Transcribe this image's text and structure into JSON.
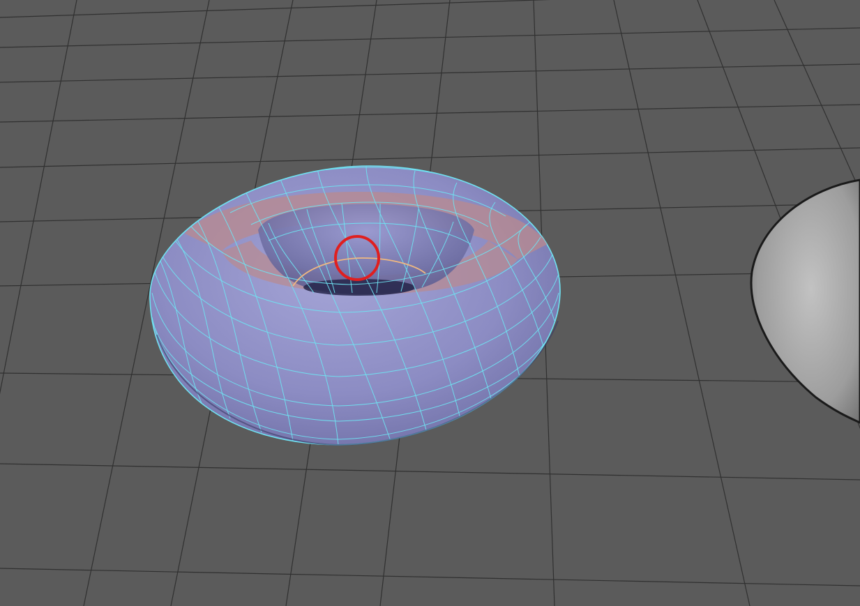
{
  "viewport": {
    "background_color": "#5b5b5b",
    "grid_color": "#2f2f2f"
  },
  "torus": {
    "fill_color": "#8f8fc6",
    "shadow_color": "#5a5a8a",
    "wire_color": "#6fe3f2",
    "selected_face_color": "#b98a8e",
    "selected_edge_color": "#f0b880"
  },
  "highlight_circle": {
    "color": "#e01f1f"
  },
  "second_object": {
    "fill_color": "#a6a6a6"
  }
}
